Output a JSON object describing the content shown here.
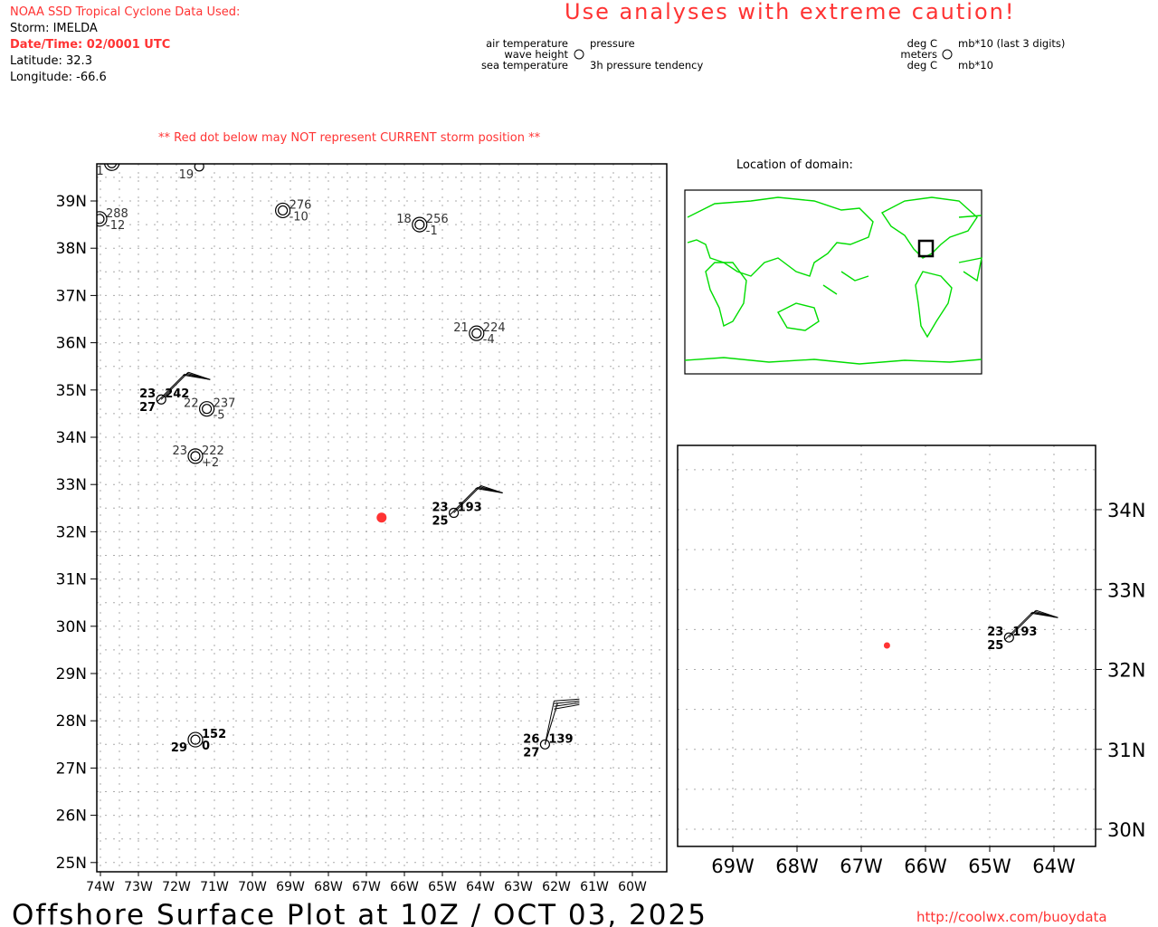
{
  "header": {
    "source": "NOAA SSD Tropical Cyclone Data Used:",
    "storm": "Storm: IMELDA",
    "datetime": "Date/Time: 02/0001 UTC",
    "latitude": "Latitude: 32.3",
    "longitude": "Longitude: -66.6",
    "caution": "Use analyses with extreme caution!",
    "red_dot_note": "** Red dot below may NOT represent CURRENT storm position **"
  },
  "legend": {
    "air_temp": "air temperature",
    "pressure": "pressure",
    "wave_height": "wave height",
    "sea_temp": "sea temperature",
    "tendency": "3h pressure tendency",
    "unit_air": "deg C",
    "unit_pressure": "mb*10 (last 3 digits)",
    "unit_wave": "meters",
    "unit_sea": "deg C",
    "unit_tendency": "mb*10"
  },
  "location_title": "Location of domain:",
  "main_map": {
    "lat_ticks": [
      "39N",
      "38N",
      "37N",
      "36N",
      "35N",
      "34N",
      "33N",
      "32N",
      "31N",
      "30N",
      "29N",
      "28N",
      "27N",
      "26N",
      "25N"
    ],
    "lon_ticks": [
      "74W",
      "73W",
      "72W",
      "71W",
      "70W",
      "69W",
      "68W",
      "67W",
      "66W",
      "65W",
      "64W",
      "63W",
      "62W",
      "61W",
      "60W"
    ],
    "storm": {
      "lat": 32.3,
      "lon": -66.6,
      "color": "#ff3333"
    },
    "stations": [
      {
        "lat": 39.8,
        "lon": -73.7,
        "double": true,
        "bold": false,
        "ul": "",
        "ur": "",
        "ll": "1",
        "lr": ""
      },
      {
        "lat": 39.73,
        "lon": -71.4,
        "double": false,
        "bold": false,
        "ul": "",
        "ur": "",
        "ll": "19",
        "lr": ""
      },
      {
        "lat": 38.62,
        "lon": -74.1,
        "double": true,
        "bold": false,
        "ul": "",
        "ur": "288",
        "ll": "",
        "lr": "-12"
      },
      {
        "lat": 38.8,
        "lon": -69.2,
        "double": true,
        "bold": false,
        "ul": "",
        "ur": "276",
        "ll": "",
        "lr": "-10"
      },
      {
        "lat": 38.5,
        "lon": -65.6,
        "double": true,
        "bold": false,
        "ul": "18",
        "ur": "256",
        "ll": "",
        "lr": "-1"
      },
      {
        "lat": 36.2,
        "lon": -64.1,
        "double": true,
        "bold": false,
        "ul": "21",
        "ur": "224",
        "ll": "",
        "lr": "-4"
      },
      {
        "lat": 34.8,
        "lon": -72.4,
        "double": false,
        "bold": true,
        "ul": "23",
        "ur": "242",
        "ll": "27",
        "lr": "",
        "barb": true
      },
      {
        "lat": 34.6,
        "lon": -71.2,
        "double": true,
        "bold": false,
        "ul": "22",
        "ur": "237",
        "ll": "",
        "lr": "-5"
      },
      {
        "lat": 33.6,
        "lon": -71.5,
        "double": true,
        "bold": false,
        "ul": "23",
        "ur": "222",
        "ll": "",
        "lr": "+2"
      },
      {
        "lat": 32.4,
        "lon": -64.7,
        "double": false,
        "bold": true,
        "ul": "23",
        "ur": "193",
        "ll": "25",
        "lr": "",
        "barb": true
      },
      {
        "lat": 27.6,
        "lon": -71.5,
        "double": true,
        "bold": true,
        "ul": "",
        "ur": "152",
        "ll": "29",
        "lr": "0"
      },
      {
        "lat": 27.5,
        "lon": -62.3,
        "double": false,
        "bold": true,
        "ul": "26",
        "ur": "139",
        "ll": "27",
        "lr": "",
        "barb": true,
        "tall": true
      }
    ]
  },
  "inset_map": {
    "lat_ticks": [
      "34N",
      "33N",
      "32N",
      "31N",
      "30N"
    ],
    "lon_ticks": [
      "69W",
      "68W",
      "67W",
      "66W",
      "65W",
      "64W"
    ],
    "storm": {
      "lat": 32.3,
      "lon": -66.6
    },
    "station": {
      "lat": 32.4,
      "lon": -64.7,
      "ul": "23",
      "ur": "193",
      "ll": "25"
    }
  },
  "footer": {
    "title": "Offshore Surface Plot at 10Z / OCT 03, 2025",
    "url": "http://coolwx.com/buoydata"
  },
  "colors": {
    "accent_red": "#ff3333",
    "coast": "#00dd00"
  }
}
